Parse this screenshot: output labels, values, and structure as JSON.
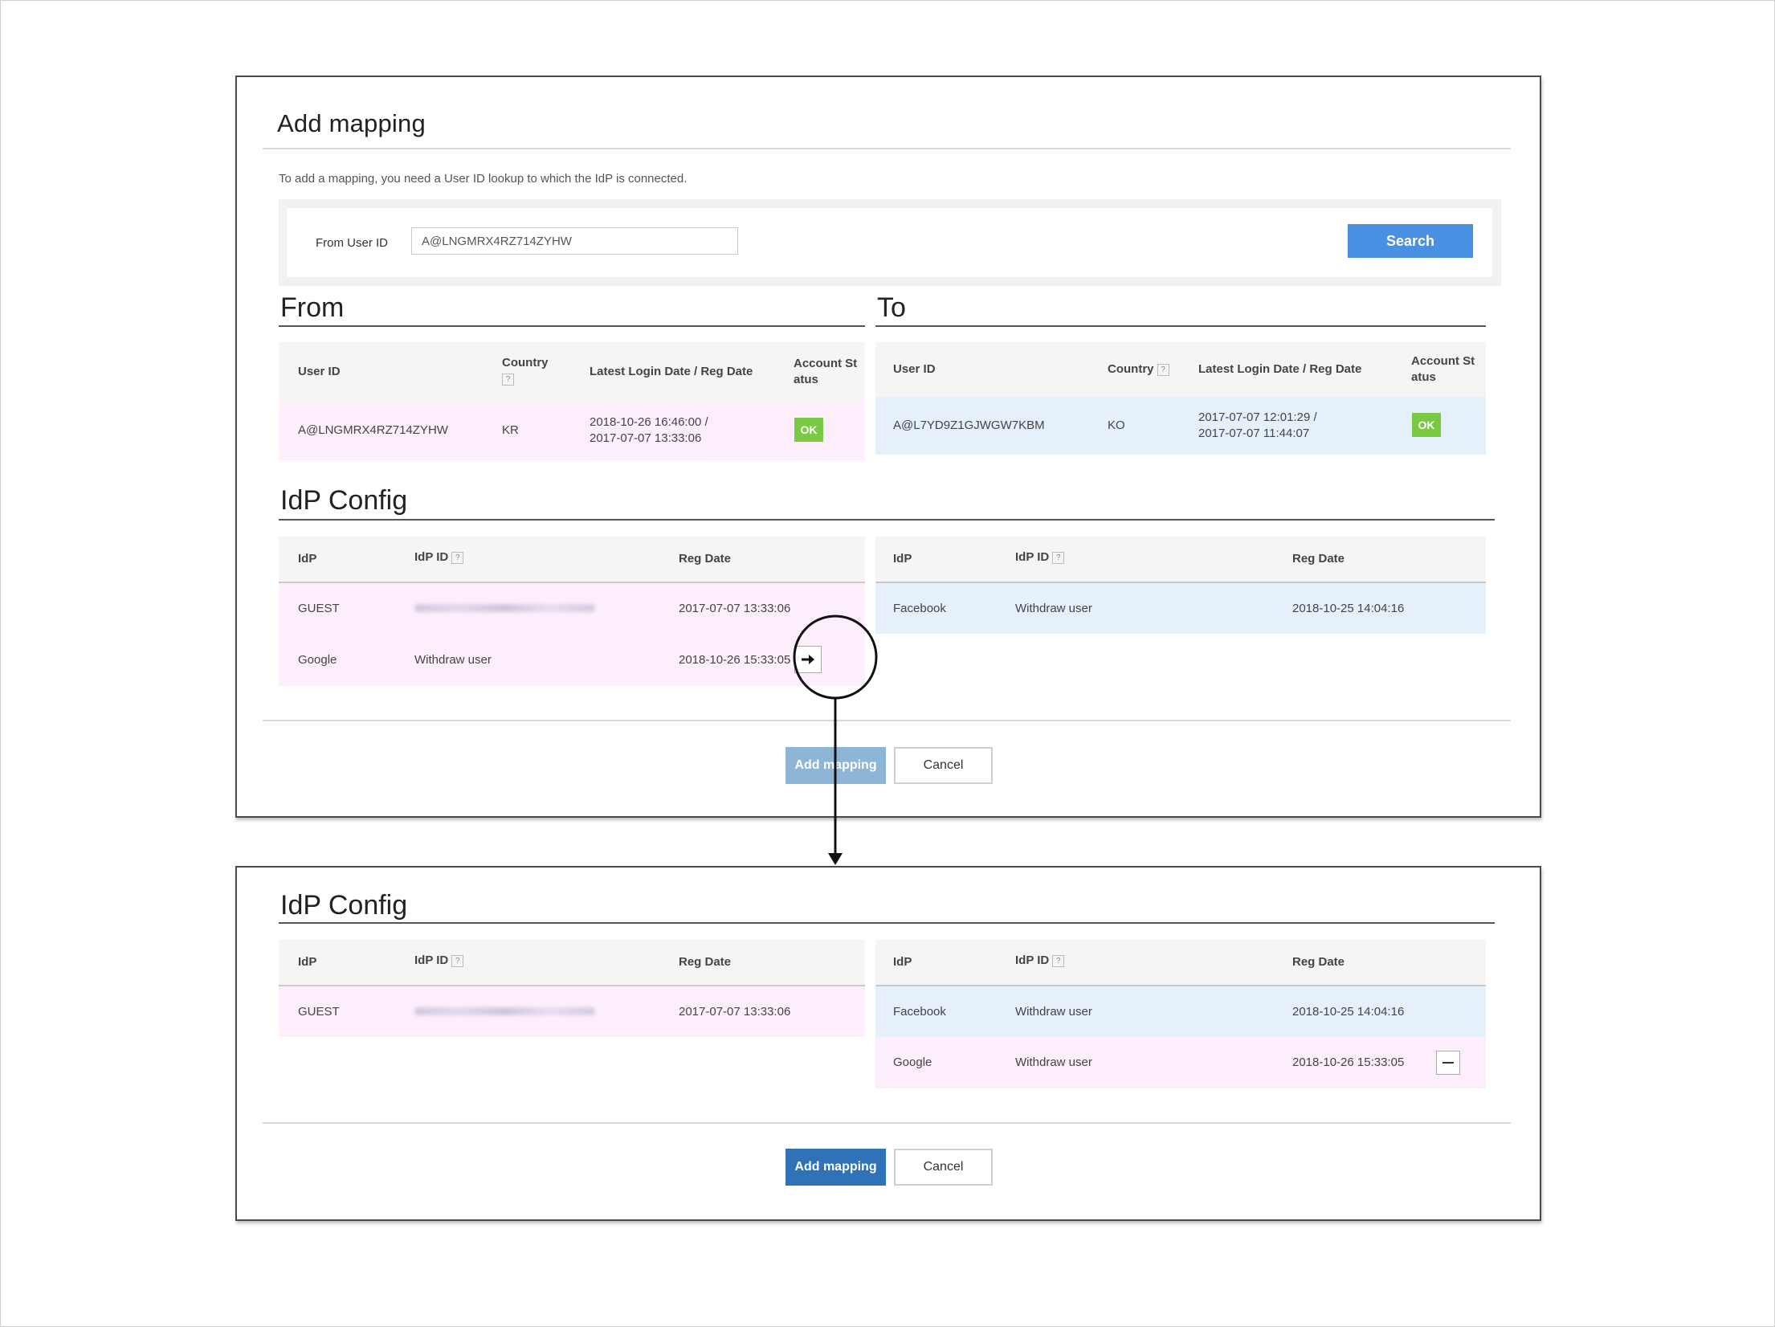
{
  "top_panel": {
    "title": "Add mapping",
    "description": "To add a mapping, you need a User ID lookup to which the IdP is connected.",
    "search": {
      "label": "From User ID",
      "value": "A@LNGMRX4RZ714ZYHW",
      "button_label": "Search"
    },
    "from": {
      "heading": "From",
      "headers": {
        "user_id": "User ID",
        "country": "Country",
        "login": "Latest Login Date / Reg Date",
        "status_1": "Account St",
        "status_2": "atus"
      },
      "row": {
        "user_id": "A@LNGMRX4RZ714ZYHW",
        "country": "KR",
        "login_1": "2018-10-26 16:46:00 /",
        "login_2": "2017-07-07 13:33:06",
        "status": "OK"
      }
    },
    "to": {
      "heading": "To",
      "headers": {
        "user_id": "User ID",
        "country": "Country",
        "login": "Latest Login Date / Reg Date",
        "status_1": "Account St",
        "status_2": "atus"
      },
      "row": {
        "user_id": "A@L7YD9Z1GJWGW7KBM",
        "country": "KO",
        "login_1": "2017-07-07 12:01:29 /",
        "login_2": "2017-07-07 11:44:07",
        "status": "OK"
      }
    },
    "idp_config": {
      "heading": "IdP Config",
      "headers": {
        "idp": "IdP",
        "idp_id": "IdP ID",
        "reg_date": "Reg Date"
      },
      "from_rows": [
        {
          "idp": "GUEST",
          "idp_id": "",
          "reg_date": "2017-07-07 13:33:06"
        },
        {
          "idp": "Google",
          "idp_id": "Withdraw user",
          "reg_date": "2018-10-26 15:33:05"
        }
      ],
      "to_rows": [
        {
          "idp": "Facebook",
          "idp_id": "Withdraw user",
          "reg_date": "2018-10-25 14:04:16"
        }
      ]
    },
    "buttons": {
      "add_mapping": "Add mapping",
      "cancel": "Cancel"
    }
  },
  "bottom_panel": {
    "idp_config": {
      "heading": "IdP Config",
      "headers": {
        "idp": "IdP",
        "idp_id": "IdP ID",
        "reg_date": "Reg Date"
      },
      "from_rows": [
        {
          "idp": "GUEST",
          "idp_id": "",
          "reg_date": "2017-07-07 13:33:06"
        }
      ],
      "to_rows": [
        {
          "idp": "Facebook",
          "idp_id": "Withdraw user",
          "reg_date": "2018-10-25 14:04:16"
        },
        {
          "idp": "Google",
          "idp_id": "Withdraw user",
          "reg_date": "2018-10-26 15:33:05"
        }
      ]
    },
    "buttons": {
      "add_mapping": "Add mapping",
      "cancel": "Cancel"
    }
  },
  "help_icon_glyph": "?",
  "colors": {
    "from_row": "#fdeefb",
    "to_row": "#e6f0fb",
    "ok_badge": "#7ac943",
    "search_button": "#4a90e2",
    "add_mapping_disabled": "#8eb4d6",
    "add_mapping_enabled": "#2f72b8"
  }
}
